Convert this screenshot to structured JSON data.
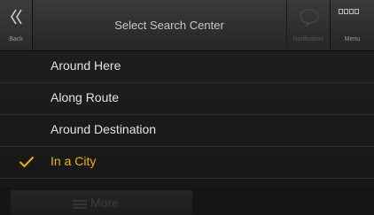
{
  "header": {
    "title": "Select Search Center",
    "back_label": "Back",
    "notification_label": "Notification",
    "menu_label": "Menu"
  },
  "list": {
    "items": [
      {
        "label": "Around Here",
        "selected": false
      },
      {
        "label": "Along Route",
        "selected": false
      },
      {
        "label": "Around Destination",
        "selected": false
      },
      {
        "label": "In a City",
        "selected": true
      }
    ]
  },
  "footer": {
    "more_label": "More"
  },
  "colors": {
    "accent": "#f2b400",
    "text": "#e4e4e4",
    "background": "#1b1b1b"
  },
  "icons": {
    "back": "double-chevron-left-icon",
    "notification": "speech-bubble-icon",
    "menu": "grid-squares-icon",
    "check": "checkmark-icon",
    "more": "list-lines-icon"
  }
}
